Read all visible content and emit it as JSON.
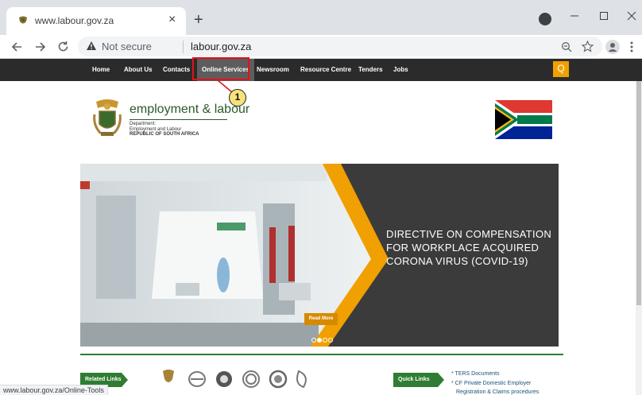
{
  "browser": {
    "tab_title": "www.labour.gov.za",
    "tab_close": "×",
    "new_tab": "+",
    "security": "Not secure",
    "address": "labour.gov.za",
    "status_url": "www.labour.gov.za/Online-Tools",
    "icons": [
      "back-icon",
      "forward-icon",
      "reload-icon",
      "warning-icon",
      "zoom-icon",
      "star-icon",
      "avatar-icon",
      "menu-icon"
    ]
  },
  "site_nav": {
    "items": [
      "Home",
      "About Us",
      "Contacts",
      "Online Services",
      "Newsroom",
      "Resource Centre",
      "Tenders",
      "Jobs"
    ],
    "search_icon": "Q",
    "step_badge": "1"
  },
  "logo": {
    "title": "employment & labour",
    "line1": "Department:",
    "line2": "Employment and Labour",
    "line3": "REPUBLIC OF SOUTH AFRICA"
  },
  "hero": {
    "headline": "DIRECTIVE ON COMPENSATION FOR WORKPLACE ACQUIRED CORONA VIRUS (COVID-19)",
    "button": "Read More"
  },
  "bottom": {
    "related_links": "Related Links",
    "quick_links": "Quick Links",
    "quick_items": [
      "TERS Documents",
      "CF Private Domestic Employer",
      "Registration & Claims procedures"
    ]
  },
  "colors": {
    "nav_bg": "#2b2b2b",
    "brand_green": "#2f7d32",
    "accent_orange": "#f0a000",
    "highlight_red": "#e0131a"
  }
}
